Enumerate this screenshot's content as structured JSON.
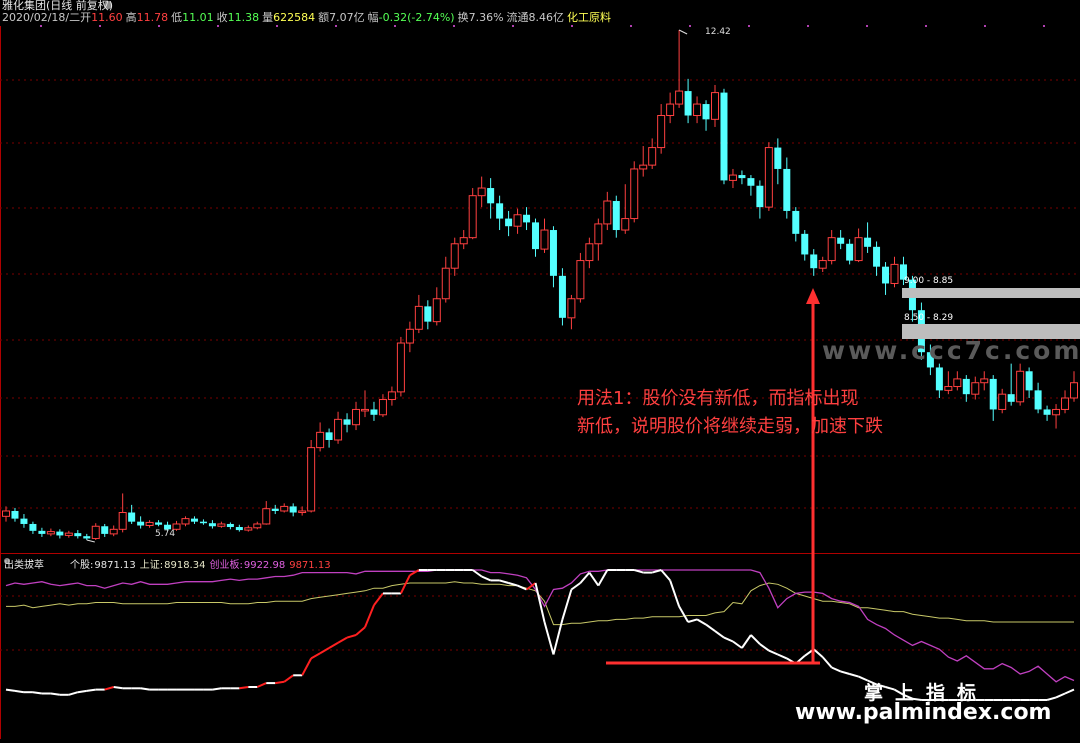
{
  "header": {
    "name": "雅化集团(日线 前复权)",
    "date": "2020/02/18/二",
    "open_label": "开",
    "open": "11.60",
    "high_label": "高",
    "high": "11.78",
    "low_label": "低",
    "low": "11.01",
    "close_label": "收",
    "close": "11.38",
    "vol_label": "量",
    "vol": "622584",
    "amount_label": "额",
    "amount": "7.07亿",
    "change_label": "幅",
    "change": "-0.32(-2.74%)",
    "turnover_label": "换",
    "turnover": "7.36%",
    "float_label": "流通",
    "float": "8.46亿",
    "industry": "化工原料",
    "high_marker": "12.42",
    "low_marker": "5.74"
  },
  "zones": [
    {
      "label": "9.00 - 8.85"
    },
    {
      "label": "8.50 - 8.29"
    }
  ],
  "indicator": {
    "name": "出类拔萃",
    "stock_label": "个股:",
    "stock_value": "9871.13",
    "sh_label": "上证:",
    "sh_value": "8918.34",
    "cy_label": "创业板:",
    "cy_value": "9922.98",
    "extra_value": "9871.13"
  },
  "annotation": {
    "line1": "用法1：股价没有新低，而指标出现",
    "line2": "新低，说明股价将继续走弱，加速下跌"
  },
  "watermarks": {
    "mid": "www.ccc7c.com",
    "cn": "掌上指标",
    "url": "www.palmindex.com"
  },
  "colors": {
    "up": "#ff4040",
    "down": "#54ffff",
    "white_line": "#ffffff",
    "magenta_line": "#c040c0",
    "yellow_line": "#c8c868",
    "red_line": "#ff2020",
    "grid": "#7a0000",
    "zone": "#bdbdbd"
  },
  "chart_data": {
    "type": "candlestick",
    "price_high": 12.42,
    "price_low": 5.74,
    "candles": [
      [
        6.05,
        6.12,
        6.18,
        5.98
      ],
      [
        6.12,
        6.02,
        6.16,
        5.98
      ],
      [
        6.02,
        5.95,
        6.08,
        5.9
      ],
      [
        5.95,
        5.86,
        5.98,
        5.82
      ],
      [
        5.86,
        5.82,
        5.9,
        5.78
      ],
      [
        5.82,
        5.85,
        5.89,
        5.79
      ],
      [
        5.85,
        5.8,
        5.88,
        5.76
      ],
      [
        5.8,
        5.83,
        5.86,
        5.77
      ],
      [
        5.83,
        5.79,
        5.87,
        5.76
      ],
      [
        5.79,
        5.76,
        5.82,
        5.74
      ],
      [
        5.76,
        5.92,
        5.96,
        5.74
      ],
      [
        5.92,
        5.82,
        5.95,
        5.78
      ],
      [
        5.82,
        5.88,
        5.93,
        5.79
      ],
      [
        5.88,
        6.1,
        6.35,
        5.84
      ],
      [
        6.1,
        5.98,
        6.2,
        5.95
      ],
      [
        5.98,
        5.93,
        6.05,
        5.89
      ],
      [
        5.93,
        5.97,
        6.0,
        5.9
      ],
      [
        5.97,
        5.94,
        6.0,
        5.92
      ],
      [
        5.94,
        5.88,
        5.98,
        5.86
      ],
      [
        5.88,
        5.95,
        5.99,
        5.86
      ],
      [
        5.95,
        6.02,
        6.05,
        5.92
      ],
      [
        6.02,
        5.98,
        6.05,
        5.95
      ],
      [
        5.98,
        5.96,
        6.01,
        5.94
      ],
      [
        5.96,
        5.92,
        6.0,
        5.89
      ],
      [
        5.92,
        5.95,
        5.98,
        5.9
      ],
      [
        5.95,
        5.91,
        5.97,
        5.88
      ],
      [
        5.91,
        5.87,
        5.94,
        5.85
      ],
      [
        5.87,
        5.9,
        5.93,
        5.85
      ],
      [
        5.9,
        5.95,
        5.98,
        5.88
      ],
      [
        5.95,
        6.15,
        6.25,
        5.94
      ],
      [
        6.15,
        6.12,
        6.2,
        6.08
      ],
      [
        6.12,
        6.18,
        6.22,
        6.1
      ],
      [
        6.18,
        6.1,
        6.22,
        6.05
      ],
      [
        6.1,
        6.12,
        6.18,
        6.06
      ],
      [
        6.12,
        6.95,
        7.05,
        6.1
      ],
      [
        6.95,
        7.15,
        7.28,
        6.9
      ],
      [
        7.15,
        7.05,
        7.2,
        6.95
      ],
      [
        7.05,
        7.32,
        7.42,
        7.0
      ],
      [
        7.32,
        7.25,
        7.4,
        7.15
      ],
      [
        7.25,
        7.45,
        7.55,
        7.18
      ],
      [
        7.45,
        7.45,
        7.7,
        7.35
      ],
      [
        7.45,
        7.38,
        7.55,
        7.3
      ],
      [
        7.38,
        7.58,
        7.65,
        7.35
      ],
      [
        7.58,
        7.68,
        7.75,
        7.5
      ],
      [
        7.68,
        8.32,
        8.4,
        7.62
      ],
      [
        8.32,
        8.5,
        8.6,
        8.2
      ],
      [
        8.5,
        8.8,
        8.95,
        8.45
      ],
      [
        8.8,
        8.6,
        8.88,
        8.5
      ],
      [
        8.6,
        8.9,
        9.05,
        8.55
      ],
      [
        8.9,
        9.3,
        9.45,
        8.85
      ],
      [
        9.3,
        9.62,
        9.7,
        9.2
      ],
      [
        9.62,
        9.7,
        9.8,
        9.55
      ],
      [
        9.7,
        10.25,
        10.35,
        9.68
      ],
      [
        10.25,
        10.35,
        10.5,
        10.1
      ],
      [
        10.35,
        10.15,
        10.48,
        9.95
      ],
      [
        10.15,
        9.95,
        10.25,
        9.8
      ],
      [
        9.95,
        9.85,
        10.05,
        9.72
      ],
      [
        9.85,
        10.0,
        10.08,
        9.75
      ],
      [
        10.0,
        9.9,
        10.1,
        9.8
      ],
      [
        9.9,
        9.55,
        9.95,
        9.45
      ],
      [
        9.55,
        9.8,
        9.95,
        9.5
      ],
      [
        9.8,
        9.2,
        9.85,
        9.05
      ],
      [
        9.2,
        8.65,
        9.3,
        8.55
      ],
      [
        8.65,
        8.9,
        8.95,
        8.5
      ],
      [
        8.9,
        9.4,
        9.5,
        8.85
      ],
      [
        9.4,
        9.62,
        9.7,
        9.3
      ],
      [
        9.62,
        9.88,
        9.95,
        9.4
      ],
      [
        9.88,
        10.18,
        10.3,
        9.8
      ],
      [
        10.18,
        9.8,
        10.25,
        9.7
      ],
      [
        9.8,
        9.95,
        10.4,
        9.75
      ],
      [
        9.95,
        10.6,
        10.7,
        9.9
      ],
      [
        10.6,
        10.65,
        10.9,
        10.5
      ],
      [
        10.65,
        10.88,
        11.0,
        10.6
      ],
      [
        10.88,
        11.3,
        11.45,
        10.8
      ],
      [
        11.3,
        11.45,
        11.6,
        11.2
      ],
      [
        11.45,
        11.62,
        12.42,
        11.4
      ],
      [
        11.62,
        11.3,
        11.78,
        11.2
      ],
      [
        11.3,
        11.45,
        11.55,
        11.2
      ],
      [
        11.45,
        11.25,
        11.5,
        11.1
      ],
      [
        11.25,
        11.6,
        11.7,
        11.15
      ],
      [
        11.6,
        10.45,
        11.65,
        10.4
      ],
      [
        10.45,
        10.52,
        10.6,
        10.35
      ],
      [
        10.52,
        10.48,
        10.58,
        10.4
      ],
      [
        10.48,
        10.38,
        10.52,
        10.25
      ],
      [
        10.38,
        10.1,
        10.45,
        9.95
      ],
      [
        10.1,
        10.88,
        10.95,
        10.05
      ],
      [
        10.88,
        10.6,
        11.0,
        10.4
      ],
      [
        10.6,
        10.05,
        10.75,
        9.95
      ],
      [
        10.05,
        9.75,
        10.1,
        9.65
      ],
      [
        9.75,
        9.48,
        9.8,
        9.4
      ],
      [
        9.48,
        9.3,
        9.55,
        9.2
      ],
      [
        9.3,
        9.4,
        9.45,
        9.25
      ],
      [
        9.4,
        9.7,
        9.8,
        9.35
      ],
      [
        9.7,
        9.62,
        9.8,
        9.55
      ],
      [
        9.62,
        9.4,
        9.68,
        9.35
      ],
      [
        9.4,
        9.7,
        9.82,
        9.38
      ],
      [
        9.7,
        9.58,
        9.9,
        9.5
      ],
      [
        9.58,
        9.32,
        9.65,
        9.2
      ],
      [
        9.32,
        9.1,
        9.38,
        8.95
      ],
      [
        9.1,
        9.35,
        9.45,
        9.05
      ],
      [
        9.35,
        9.15,
        9.45,
        9.08
      ],
      [
        9.15,
        8.75,
        9.2,
        8.6
      ],
      [
        8.75,
        8.2,
        8.85,
        8.1
      ],
      [
        8.2,
        8.0,
        8.3,
        7.9
      ],
      [
        8.0,
        7.7,
        8.05,
        7.6
      ],
      [
        7.7,
        7.75,
        7.95,
        7.65
      ],
      [
        7.75,
        7.85,
        7.95,
        7.7
      ],
      [
        7.85,
        7.65,
        7.9,
        7.55
      ],
      [
        7.65,
        7.8,
        7.88,
        7.58
      ],
      [
        7.8,
        7.85,
        7.95,
        7.7
      ],
      [
        7.85,
        7.45,
        7.9,
        7.3
      ],
      [
        7.45,
        7.65,
        7.72,
        7.4
      ],
      [
        7.65,
        7.55,
        8.05,
        7.5
      ],
      [
        7.55,
        7.95,
        8.05,
        7.5
      ],
      [
        7.95,
        7.7,
        8.0,
        7.6
      ],
      [
        7.7,
        7.45,
        7.8,
        7.4
      ],
      [
        7.45,
        7.38,
        7.5,
        7.3
      ],
      [
        7.38,
        7.45,
        7.52,
        7.2
      ],
      [
        7.45,
        7.6,
        7.7,
        7.4
      ],
      [
        7.6,
        7.8,
        7.95,
        7.55
      ]
    ],
    "series": [
      {
        "name": "个股",
        "values": [
          0.08,
          0.07,
          0.06,
          0.06,
          0.05,
          0.05,
          0.04,
          0.04,
          0.06,
          0.07,
          0.08,
          0.08,
          0.1,
          0.09,
          0.09,
          0.09,
          0.08,
          0.08,
          0.08,
          0.08,
          0.08,
          0.08,
          0.08,
          0.08,
          0.09,
          0.09,
          0.09,
          0.1,
          0.1,
          0.13,
          0.13,
          0.14,
          0.19,
          0.19,
          0.32,
          0.36,
          0.4,
          0.44,
          0.48,
          0.5,
          0.56,
          0.73,
          0.82,
          0.82,
          0.82,
          0.96,
          1.0,
          1.0,
          1.0,
          1.0,
          1.0,
          1.0,
          1.0,
          0.95,
          0.92,
          0.92,
          0.9,
          0.88,
          0.85,
          0.9,
          0.6,
          0.35,
          0.62,
          0.85,
          0.9,
          0.98,
          0.88,
          1.0,
          1.0,
          1.0,
          1.0,
          0.98,
          0.98,
          1.0,
          0.92,
          0.72,
          0.6,
          0.62,
          0.58,
          0.53,
          0.48,
          0.45,
          0.4,
          0.5,
          0.43,
          0.38,
          0.35,
          0.32,
          0.28,
          0.34,
          0.39,
          0.33,
          0.25,
          0.22,
          0.2,
          0.18,
          0.15,
          0.12,
          0.1,
          0.08,
          0.04,
          0.01,
          0.0,
          0.0,
          0.0,
          0.0,
          0.0,
          0.0,
          0.0,
          0.0,
          0.0,
          0.0,
          0.0,
          0.0,
          0.0,
          0.0,
          0.0,
          0.02,
          0.05,
          0.08
        ]
      },
      {
        "name": "上证",
        "values": [
          0.72,
          0.72,
          0.73,
          0.71,
          0.72,
          0.73,
          0.74,
          0.73,
          0.74,
          0.74,
          0.75,
          0.75,
          0.75,
          0.74,
          0.74,
          0.74,
          0.74,
          0.74,
          0.74,
          0.75,
          0.75,
          0.75,
          0.75,
          0.75,
          0.75,
          0.74,
          0.74,
          0.74,
          0.75,
          0.75,
          0.76,
          0.76,
          0.76,
          0.76,
          0.78,
          0.79,
          0.8,
          0.81,
          0.82,
          0.83,
          0.84,
          0.86,
          0.86,
          0.88,
          0.89,
          0.9,
          0.9,
          0.9,
          0.9,
          0.9,
          0.91,
          0.9,
          0.9,
          0.89,
          0.89,
          0.89,
          0.88,
          0.88,
          0.86,
          0.84,
          0.76,
          0.58,
          0.58,
          0.59,
          0.59,
          0.6,
          0.61,
          0.61,
          0.62,
          0.62,
          0.63,
          0.63,
          0.64,
          0.64,
          0.64,
          0.64,
          0.65,
          0.65,
          0.65,
          0.67,
          0.68,
          0.75,
          0.74,
          0.84,
          0.88,
          0.9,
          0.89,
          0.86,
          0.82,
          0.8,
          0.78,
          0.76,
          0.76,
          0.75,
          0.74,
          0.71,
          0.71,
          0.7,
          0.69,
          0.68,
          0.68,
          0.66,
          0.65,
          0.64,
          0.63,
          0.63,
          0.62,
          0.61,
          0.61,
          0.61,
          0.6,
          0.6,
          0.6,
          0.6,
          0.6,
          0.6,
          0.6,
          0.6,
          0.6,
          0.6
        ]
      },
      {
        "name": "创业板",
        "values": [
          0.88,
          0.9,
          0.89,
          0.9,
          0.91,
          0.89,
          0.88,
          0.89,
          0.9,
          0.88,
          0.88,
          0.86,
          0.88,
          0.9,
          0.89,
          0.91,
          0.89,
          0.89,
          0.89,
          0.9,
          0.91,
          0.91,
          0.91,
          0.91,
          0.92,
          0.93,
          0.92,
          0.93,
          0.93,
          0.94,
          0.95,
          0.95,
          0.96,
          0.98,
          0.98,
          0.98,
          0.98,
          0.98,
          0.98,
          0.97,
          0.99,
          0.99,
          0.99,
          0.99,
          0.99,
          0.99,
          0.99,
          0.99,
          1.0,
          1.0,
          1.0,
          1.0,
          1.0,
          1.0,
          0.98,
          0.98,
          0.97,
          0.96,
          0.94,
          0.85,
          0.72,
          0.85,
          0.86,
          0.9,
          0.97,
          0.99,
          0.99,
          1.0,
          1.0,
          1.0,
          1.0,
          1.0,
          1.0,
          1.0,
          1.0,
          1.0,
          1.0,
          1.0,
          1.0,
          1.0,
          1.0,
          1.0,
          1.0,
          1.0,
          0.98,
          0.86,
          0.71,
          0.78,
          0.82,
          0.83,
          0.83,
          0.82,
          0.78,
          0.76,
          0.75,
          0.72,
          0.62,
          0.58,
          0.55,
          0.5,
          0.46,
          0.42,
          0.45,
          0.42,
          0.39,
          0.33,
          0.3,
          0.34,
          0.29,
          0.24,
          0.24,
          0.28,
          0.25,
          0.2,
          0.22,
          0.26,
          0.2,
          0.14,
          0.18,
          0.15
        ]
      }
    ]
  }
}
